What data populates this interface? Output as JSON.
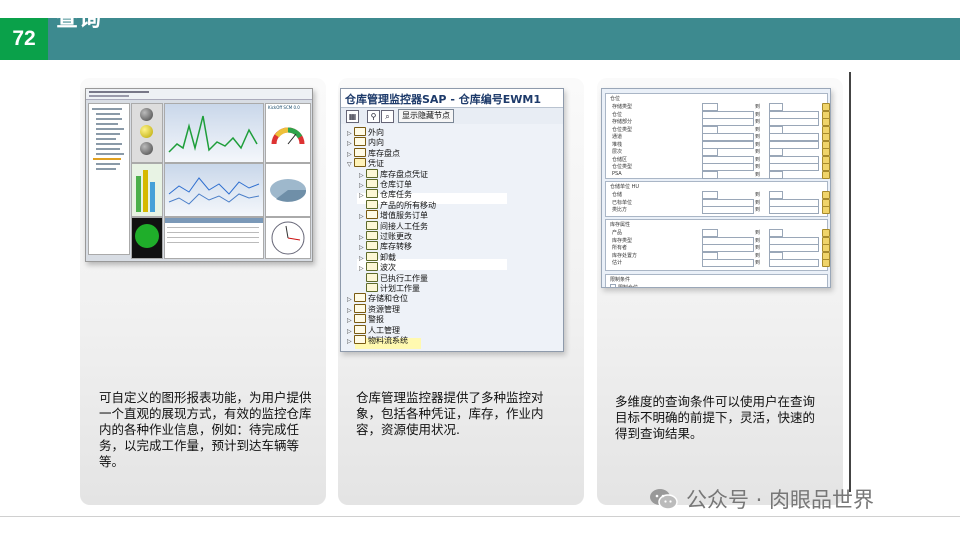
{
  "header": {
    "page_number": "72",
    "title": "查询"
  },
  "cards": [
    {
      "description": "可自定义的图形报表功能，为用户提供一个直观的展现方式，有效的监控仓库内的各种作业信息，例如：待完成任务，以完成工作量，预计到达车辆等等。"
    },
    {
      "description": "仓库管理监控器提供了多种监控对象，包括各种凭证，库存，作业内容，资源使用状况."
    },
    {
      "description": "多维度的查询条件可以使用户在查询目标不明确的前提下，灵活，快速的得到查询结果。"
    }
  ],
  "screenshot_monitor": {
    "title": "仓库管理监控器SAP - 仓库编号EWM1",
    "toolbar_button": "显示隐藏节点",
    "nodes": [
      {
        "label": "外向",
        "level": 0,
        "type": "folder"
      },
      {
        "label": "内向",
        "level": 0,
        "type": "folder"
      },
      {
        "label": "库存盘点",
        "level": 0,
        "type": "folder"
      },
      {
        "label": "凭证",
        "level": 0,
        "type": "folder-open"
      },
      {
        "label": "库存盘点凭证",
        "level": 1,
        "type": "doc"
      },
      {
        "label": "仓库订单",
        "level": 1,
        "type": "doc"
      },
      {
        "label": "仓库任务",
        "level": 1,
        "type": "doc"
      },
      {
        "label": "产品的所有移动",
        "level": 1,
        "type": "doc"
      },
      {
        "label": "增值服务订单",
        "level": 1,
        "type": "folder"
      },
      {
        "label": "间接人工任务",
        "level": 1,
        "type": "doc"
      },
      {
        "label": "过账更改",
        "level": 1,
        "type": "doc"
      },
      {
        "label": "库存转移",
        "level": 1,
        "type": "doc"
      },
      {
        "label": "卸载",
        "level": 1,
        "type": "doc"
      },
      {
        "label": "波次",
        "level": 1,
        "type": "doc"
      },
      {
        "label": "已执行工作量",
        "level": 1,
        "type": "doc"
      },
      {
        "label": "计划工作量",
        "level": 1,
        "type": "doc"
      },
      {
        "label": "存储和仓位",
        "level": 0,
        "type": "folder"
      },
      {
        "label": "资源管理",
        "level": 0,
        "type": "folder"
      },
      {
        "label": "警报",
        "level": 0,
        "type": "folder"
      },
      {
        "label": "人工管理",
        "level": 0,
        "type": "folder"
      },
      {
        "label": "物料流系统",
        "level": 0,
        "type": "folder"
      }
    ]
  },
  "screenshot_dashboard": {
    "kpi_title": "KickOff SCM 0.0"
  },
  "screenshot_query": {
    "to_label": "到",
    "groups": [
      {
        "title": "仓位",
        "fields": [
          "存储类型",
          "仓位",
          "存储部分",
          "仓位类型",
          "通道",
          "堆栈",
          "层次",
          "仓储区",
          "仓位类型",
          "PSA"
        ]
      },
      {
        "title": "仓储单位 HU",
        "fields": [
          "仓储",
          "已标单位",
          "类比方"
        ]
      },
      {
        "title": "库存属性",
        "fields": [
          "产品",
          "库存类型",
          "所有者",
          "库存处置方",
          "估计"
        ]
      },
      {
        "title": "限制条件",
        "fields": [
          "限制仓位"
        ]
      }
    ]
  },
  "watermark": {
    "text": "公众号 · 肉眼品世界"
  },
  "colors": {
    "header": "#3d8a8f",
    "page_number_bg": "#0aa14a"
  }
}
